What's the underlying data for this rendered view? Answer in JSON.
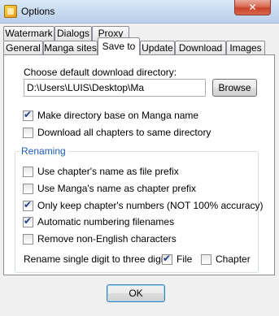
{
  "window": {
    "title": "Options",
    "close_glyph": "✕"
  },
  "tabs_row1": [
    {
      "label": "Watermark"
    },
    {
      "label": "Dialogs"
    },
    {
      "label": "Proxy"
    }
  ],
  "tabs_row2": [
    {
      "label": "General"
    },
    {
      "label": "Manga sites"
    },
    {
      "label": "Save to",
      "active": true
    },
    {
      "label": "Update"
    },
    {
      "label": "Download"
    },
    {
      "label": "Images"
    }
  ],
  "save_to": {
    "choose_dir_label": "Choose default download directory:",
    "directory_value": "D:\\Users\\LUIS\\Desktop\\Ma",
    "browse_label": "Browse",
    "make_dir_base_label": "Make directory base on Manga name",
    "make_dir_base_checked": true,
    "download_same_dir_label": "Download all chapters to same directory",
    "download_same_dir_checked": false
  },
  "renaming": {
    "title": "Renaming",
    "options": [
      {
        "label": "Use chapter's name as file prefix",
        "checked": false
      },
      {
        "label": "Use Manga's name as chapter prefix",
        "checked": false
      },
      {
        "label": "Only keep chapter's numbers (NOT 100% accuracy)",
        "checked": true
      },
      {
        "label": "Automatic numbering filenames",
        "checked": true
      },
      {
        "label": "Remove non-English characters",
        "checked": false
      }
    ],
    "rename_digit_label": "Rename single digit to three digits",
    "file_label": "File",
    "file_checked": true,
    "chapter_label": "Chapter",
    "chapter_checked": false
  },
  "footer": {
    "ok_label": "OK"
  }
}
